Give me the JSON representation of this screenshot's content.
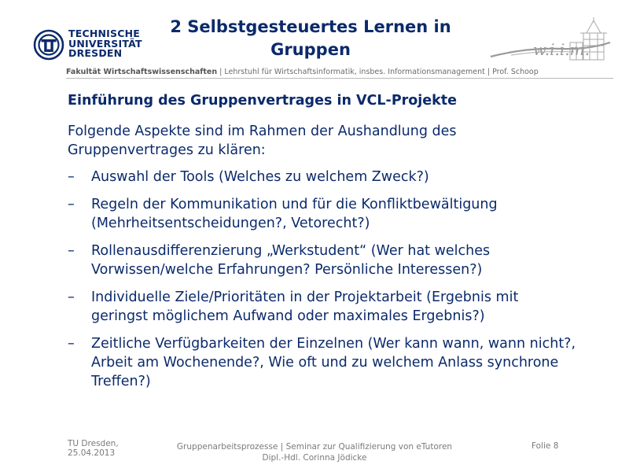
{
  "header": {
    "logo_lines": [
      "TECHNISCHE",
      "UNIVERSITÄT",
      "DRESDEN"
    ],
    "title_line1": "2 Selbstgesteuertes Lernen in",
    "title_line2": "Gruppen",
    "wiim_logo": "w.i.i.m.",
    "faculty": "Fakultät Wirtschaftswissenschaften",
    "chair": " | Lehrstuhl für Wirtschaftsinformatik, insbes. Informationsmanagement | Prof. Schoop"
  },
  "content": {
    "heading": "Einführung des Gruppenvertrages in VCL-Projekte",
    "intro": "Folgende Aspekte sind im Rahmen der Aushandlung des Gruppenvertrages zu klären:",
    "bullet_marker": "–",
    "bullets": [
      "Auswahl der Tools (Welches zu welchem Zweck?)",
      "Regeln der Kommunikation und für die Konfliktbewältigung (Mehrheitsentscheidungen?, Vetorecht?)",
      "Rollenausdifferenzierung „Werkstudent“ (Wer hat welches Vorwissen/welche Erfahrungen? Persönliche Interessen?)",
      "Individuelle Ziele/Prioritäten in der Projektarbeit (Ergebnis mit geringst möglichem Aufwand oder maximales Ergebnis?)",
      "Zeitliche Verfügbarkeiten der Einzelnen (Wer kann wann, wann nicht?, Arbeit am Wochenende?, Wie oft und zu welchem Anlass synchrone Treffen?)"
    ]
  },
  "footer": {
    "location": "TU Dresden,",
    "date": "25.04.2013",
    "course": "Gruppenarbeitsprozesse | Seminar zur Qualifizierung von eTutoren",
    "author": "Dipl.-Hdl. Corinna Jödicke",
    "slide_number": "Folie 8"
  },
  "colors": {
    "primary": "#0b2a6b",
    "muted": "#7a7a7a"
  }
}
